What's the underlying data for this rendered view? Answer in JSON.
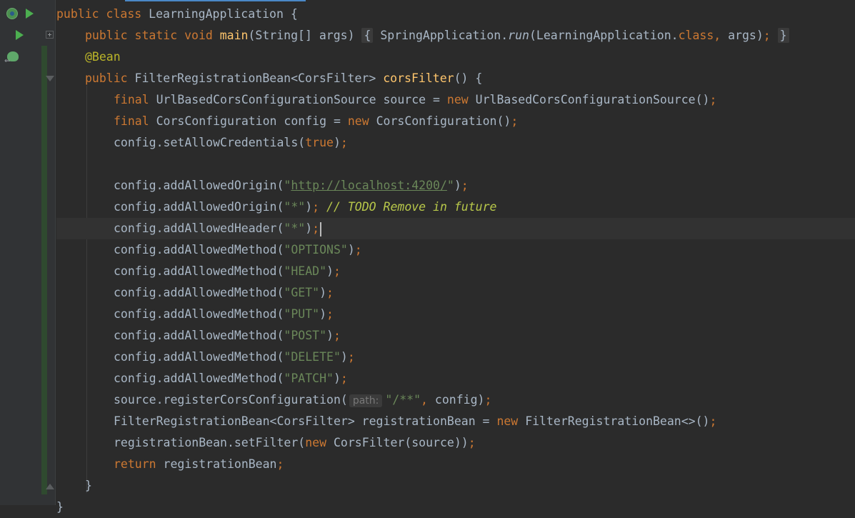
{
  "editor": {
    "lines": [
      [
        {
          "t": "public class ",
          "c": "kw"
        },
        {
          "t": "LearningApplication {"
        }
      ],
      [
        {
          "t": "public static void ",
          "c": "kw"
        },
        {
          "t": "main",
          "c": "fn"
        },
        {
          "t": "(String[] args) "
        },
        {
          "t": "{",
          "c": "box"
        },
        {
          "t": " SpringApplication."
        },
        {
          "t": "run",
          "c": "it"
        },
        {
          "t": "(LearningApplication."
        },
        {
          "t": "class",
          "c": "kw"
        },
        {
          "t": ", ",
          "c": "kw"
        },
        {
          "t": "args)"
        },
        {
          "t": ";",
          "c": "kw"
        },
        {
          "t": " "
        },
        {
          "t": "}",
          "c": "box"
        }
      ],
      [
        {
          "t": "@Bean",
          "c": "ann"
        }
      ],
      [
        {
          "t": "public ",
          "c": "kw"
        },
        {
          "t": "FilterRegistrationBean<CorsFilter> "
        },
        {
          "t": "corsFilter",
          "c": "fn"
        },
        {
          "t": "() {"
        }
      ],
      [
        {
          "t": "final ",
          "c": "kw"
        },
        {
          "t": "UrlBasedCorsConfigurationSource source = "
        },
        {
          "t": "new ",
          "c": "kw"
        },
        {
          "t": "UrlBasedCorsConfigurationSource()"
        },
        {
          "t": ";",
          "c": "kw"
        }
      ],
      [
        {
          "t": "final ",
          "c": "kw"
        },
        {
          "t": "CorsConfiguration config = "
        },
        {
          "t": "new ",
          "c": "kw"
        },
        {
          "t": "CorsConfiguration()"
        },
        {
          "t": ";",
          "c": "kw"
        }
      ],
      [
        {
          "t": "config.setAllowCredentials("
        },
        {
          "t": "true",
          "c": "kw"
        },
        {
          "t": ")"
        },
        {
          "t": ";",
          "c": "kw"
        }
      ],
      [],
      [
        {
          "t": "config.addAllowedOrigin("
        },
        {
          "t": "\"",
          "c": "str"
        },
        {
          "t": "http://localhost:4200/",
          "c": "strlink"
        },
        {
          "t": "\"",
          "c": "str"
        },
        {
          "t": ")"
        },
        {
          "t": ";",
          "c": "kw"
        }
      ],
      [
        {
          "t": "config.addAllowedOrigin("
        },
        {
          "t": "\"*\"",
          "c": "str"
        },
        {
          "t": ")"
        },
        {
          "t": "; ",
          "c": "kw"
        },
        {
          "t": "// TODO Remove in future",
          "c": "cmt"
        }
      ],
      [
        {
          "t": "config.addAllowedHeader("
        },
        {
          "t": "\"*\"",
          "c": "str"
        },
        {
          "t": ")"
        },
        {
          "t": ";",
          "c": "kw"
        },
        {
          "t": "",
          "c": "caret"
        }
      ],
      [
        {
          "t": "config.addAllowedMethod("
        },
        {
          "t": "\"OPTIONS\"",
          "c": "str"
        },
        {
          "t": ")"
        },
        {
          "t": ";",
          "c": "kw"
        }
      ],
      [
        {
          "t": "config.addAllowedMethod("
        },
        {
          "t": "\"HEAD\"",
          "c": "str"
        },
        {
          "t": ")"
        },
        {
          "t": ";",
          "c": "kw"
        }
      ],
      [
        {
          "t": "config.addAllowedMethod("
        },
        {
          "t": "\"GET\"",
          "c": "str"
        },
        {
          "t": ")"
        },
        {
          "t": ";",
          "c": "kw"
        }
      ],
      [
        {
          "t": "config.addAllowedMethod("
        },
        {
          "t": "\"PUT\"",
          "c": "str"
        },
        {
          "t": ")"
        },
        {
          "t": ";",
          "c": "kw"
        }
      ],
      [
        {
          "t": "config.addAllowedMethod("
        },
        {
          "t": "\"POST\"",
          "c": "str"
        },
        {
          "t": ")"
        },
        {
          "t": ";",
          "c": "kw"
        }
      ],
      [
        {
          "t": "config.addAllowedMethod("
        },
        {
          "t": "\"DELETE\"",
          "c": "str"
        },
        {
          "t": ")"
        },
        {
          "t": ";",
          "c": "kw"
        }
      ],
      [
        {
          "t": "config.addAllowedMethod("
        },
        {
          "t": "\"PATCH\"",
          "c": "str"
        },
        {
          "t": ")"
        },
        {
          "t": ";",
          "c": "kw"
        }
      ],
      [
        {
          "t": "source.registerCorsConfiguration("
        },
        {
          "t": "path:",
          "c": "hint"
        },
        {
          "t": "\"/**\"",
          "c": "str"
        },
        {
          "t": ", ",
          "c": "kw"
        },
        {
          "t": "config)"
        },
        {
          "t": ";",
          "c": "kw"
        }
      ],
      [
        {
          "t": "FilterRegistrationBean<CorsFilter> registrationBean = "
        },
        {
          "t": "new ",
          "c": "kw"
        },
        {
          "t": "FilterRegistrationBean<>()"
        },
        {
          "t": ";",
          "c": "kw"
        }
      ],
      [
        {
          "t": "registrationBean.setFilter("
        },
        {
          "t": "new ",
          "c": "kw"
        },
        {
          "t": "CorsFilter(source))"
        },
        {
          "t": ";",
          "c": "kw"
        }
      ],
      [
        {
          "t": "return ",
          "c": "kw"
        },
        {
          "t": "registrationBean"
        },
        {
          "t": ";",
          "c": "kw"
        }
      ],
      [
        {
          "t": "}"
        }
      ],
      [
        {
          "t": "}"
        }
      ]
    ],
    "indents": [
      0,
      1,
      1,
      1,
      2,
      2,
      2,
      2,
      2,
      2,
      2,
      2,
      2,
      2,
      2,
      2,
      2,
      2,
      2,
      2,
      2,
      2,
      1,
      0
    ],
    "current_line_index": 10
  },
  "gutter_icons": [
    "run-class-icon",
    "run-main-icon",
    "spring-bean-icon"
  ],
  "colors": {
    "background": "#2b2b2b",
    "keyword": "#cc7832",
    "string": "#6a8759",
    "annotation": "#bbb529",
    "method": "#ffc66d",
    "comment": "#b8c84a",
    "text": "#a9b7c6"
  }
}
